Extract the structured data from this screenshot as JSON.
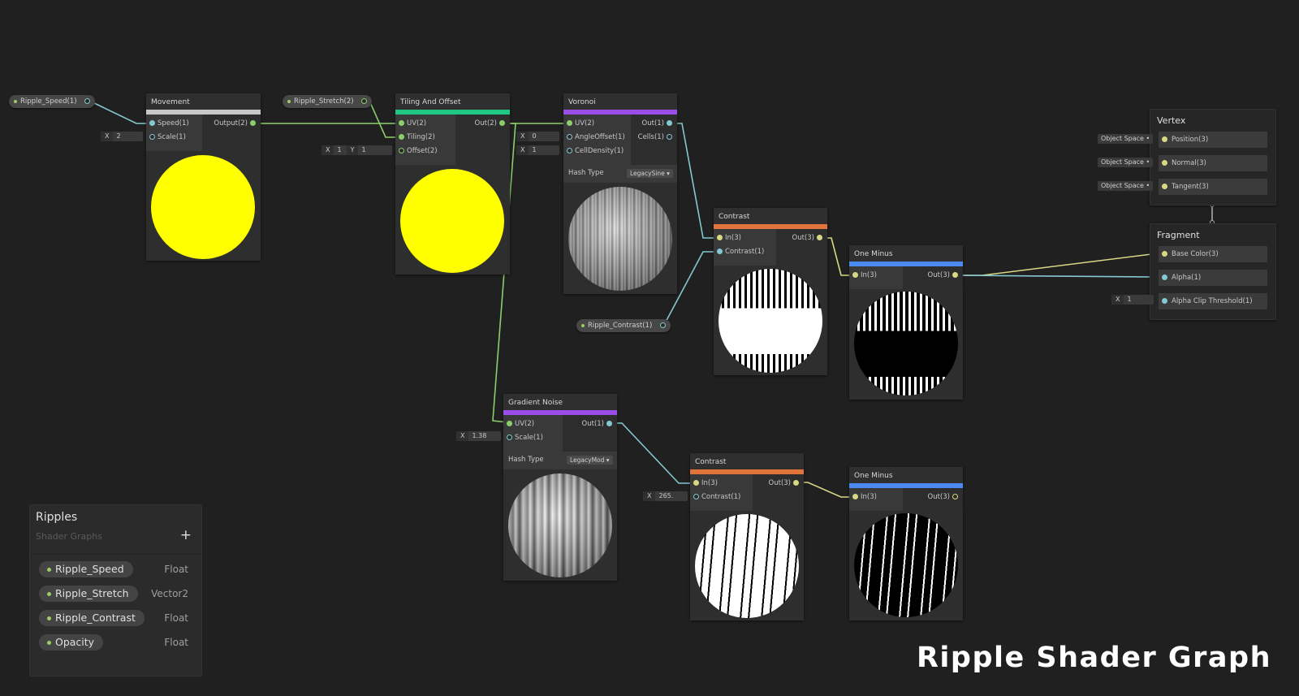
{
  "graph_title": "Ripple Shader Graph",
  "blackboard": {
    "title": "Ripples",
    "subtitle": "Shader Graphs",
    "add_button": "+",
    "properties": [
      {
        "name": "Ripple_Speed",
        "type": "Float"
      },
      {
        "name": "Ripple_Stretch",
        "type": "Vector2"
      },
      {
        "name": "Ripple_Contrast",
        "type": "Float"
      },
      {
        "name": "Opacity",
        "type": "Float"
      }
    ]
  },
  "property_nodes": {
    "ripple_speed": "Ripple_Speed(1)",
    "ripple_stretch": "Ripple_Stretch(2)",
    "ripple_contrast": "Ripple_Contrast(1)"
  },
  "nodes": {
    "movement": {
      "title": "Movement",
      "color": "#c8c8c8",
      "inputs": [
        "Speed(1)",
        "Scale(1)"
      ],
      "outputs": [
        "Output(2)"
      ],
      "scale_x_label": "X",
      "scale_value": "2"
    },
    "tiling": {
      "title": "Tiling And Offset",
      "color": "#1ec882",
      "inputs": [
        "UV(2)",
        "Tiling(2)",
        "Offset(2)"
      ],
      "outputs": [
        "Out(2)"
      ],
      "offset_x_label": "X",
      "offset_x": "1",
      "offset_y_label": "Y",
      "offset_y": "1"
    },
    "voronoi": {
      "title": "Voronoi",
      "color": "#9b4de8",
      "inputs": [
        "UV(2)",
        "AngleOffset(1)",
        "CellDensity(1)"
      ],
      "outputs": [
        "Out(1)",
        "Cells(1)"
      ],
      "hash_label": "Hash Type",
      "hash_value": "LegacySine",
      "angle_x_label": "X",
      "angle_value": "0",
      "density_x_label": "X",
      "density_value": "1"
    },
    "contrast1": {
      "title": "Contrast",
      "color": "#e0743a",
      "inputs": [
        "In(3)",
        "Contrast(1)"
      ],
      "outputs": [
        "Out(3)"
      ]
    },
    "oneminus1": {
      "title": "One Minus",
      "color": "#4a8af0",
      "inputs": [
        "In(3)"
      ],
      "outputs": [
        "Out(3)"
      ]
    },
    "gradient": {
      "title": "Gradient Noise",
      "color": "#9b4de8",
      "inputs": [
        "UV(2)",
        "Scale(1)"
      ],
      "outputs": [
        "Out(1)"
      ],
      "hash_label": "Hash Type",
      "hash_value": "LegacyMod",
      "scale_x_label": "X",
      "scale_value": "1.38"
    },
    "contrast2": {
      "title": "Contrast",
      "color": "#e0743a",
      "inputs": [
        "In(3)",
        "Contrast(1)"
      ],
      "outputs": [
        "Out(3)"
      ],
      "contrast_x_label": "X",
      "contrast_value": "265."
    },
    "oneminus2": {
      "title": "One Minus",
      "color": "#4a8af0",
      "inputs": [
        "In(3)"
      ],
      "outputs": [
        "Out(3)"
      ]
    }
  },
  "master": {
    "vertex_title": "Vertex",
    "vertex_slots": [
      "Position(3)",
      "Normal(3)",
      "Tangent(3)"
    ],
    "space_label": "Object Space",
    "fragment_title": "Fragment",
    "fragment_slots": [
      "Base Color(3)",
      "Alpha(1)",
      "Alpha Clip Threshold(1)"
    ],
    "alpha_clip_x_label": "X",
    "alpha_clip_value": "1"
  },
  "colors": {
    "vec1_wire": "#84c8d0",
    "vec2_wire": "#8ccf6a",
    "vec3_wire": "#d8d884",
    "yellow_preview": "#ffff00"
  }
}
